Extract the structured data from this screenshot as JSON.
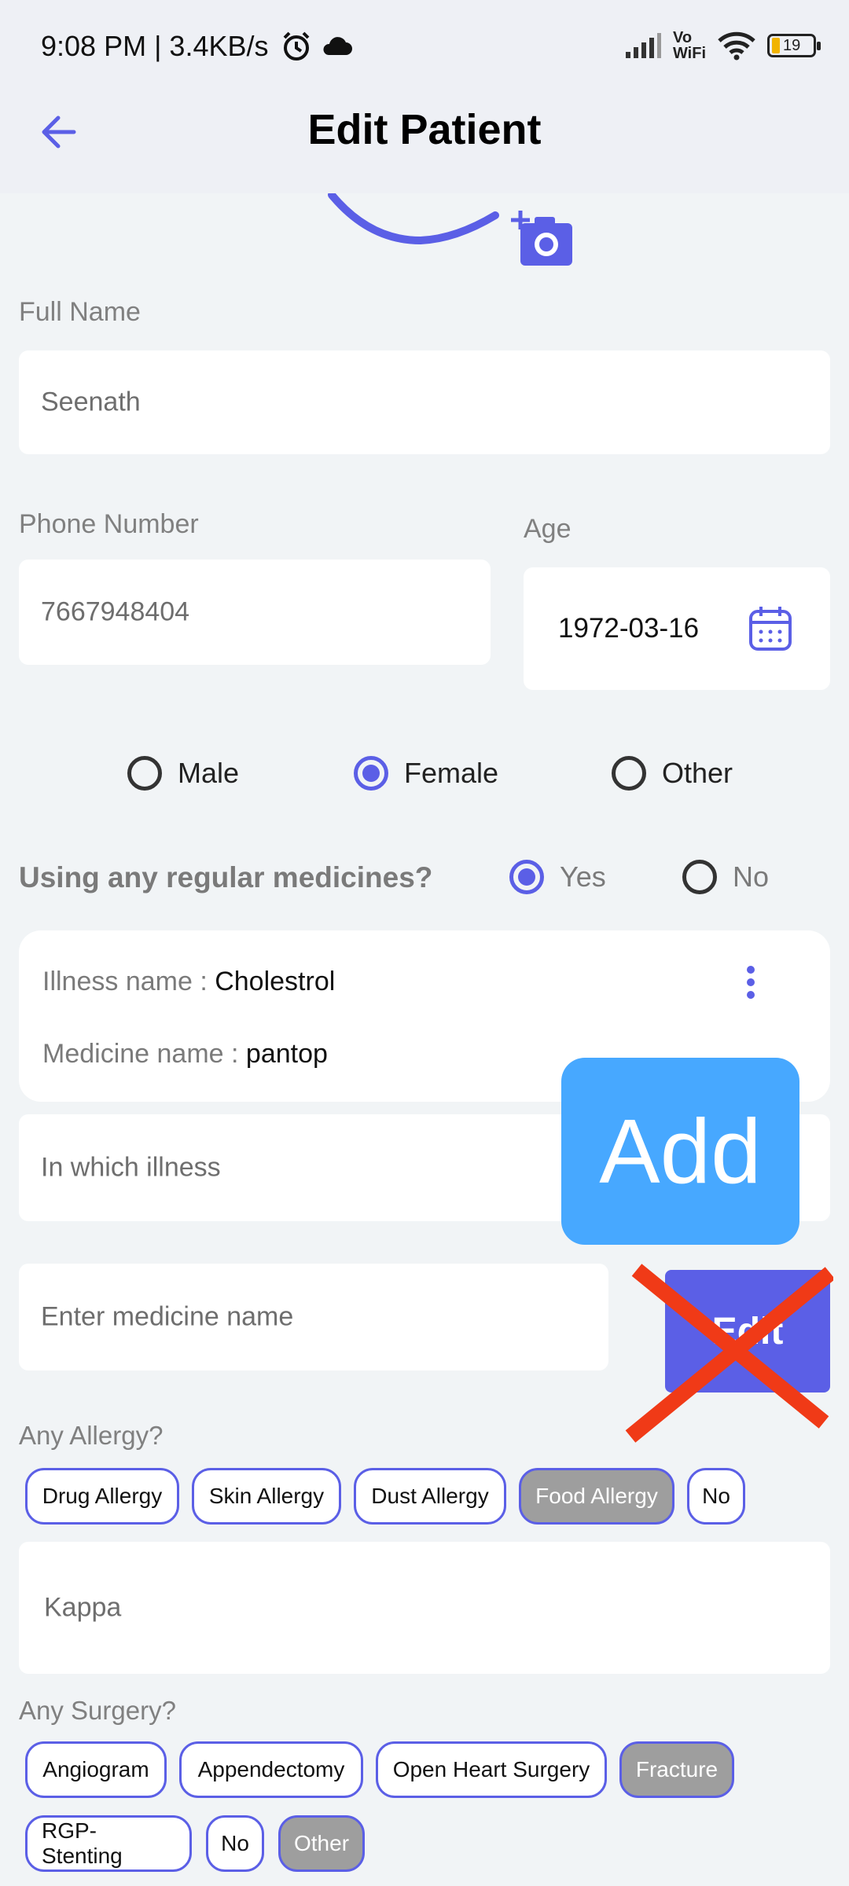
{
  "status_bar": {
    "time_speed": "9:08 PM | 3.4KB/s",
    "vowifi": "Vo\nWiFi",
    "battery": "19"
  },
  "header": {
    "title": "Edit Patient"
  },
  "full_name": {
    "label": "Full Name",
    "value": "Seenath"
  },
  "phone": {
    "label": "Phone Number",
    "value": "7667948404"
  },
  "age": {
    "label": "Age",
    "value": "1972-03-16"
  },
  "gender": {
    "options": [
      "Male",
      "Female",
      "Other"
    ],
    "selected": "Female"
  },
  "medicines": {
    "question": "Using any regular medicines?",
    "yes": "Yes",
    "no": "No",
    "selected": "Yes",
    "entry": {
      "illness_label": "Illness name : ",
      "illness_value": "Cholestrol",
      "medicine_label": "Medicine name : ",
      "medicine_value": "pantop"
    },
    "illness_placeholder": "In which illness",
    "medicine_placeholder": "Enter medicine name",
    "add_label": "Add",
    "edit_label": "Edit"
  },
  "allergy": {
    "question": "Any Allergy?",
    "chips": [
      "Drug Allergy",
      "Skin Allergy",
      "Dust Allergy",
      "Food Allergy",
      "No"
    ],
    "selected": [
      "Food Allergy"
    ],
    "note": "Kappa"
  },
  "surgery": {
    "question": "Any Surgery?",
    "chips": [
      "Angiogram",
      "Appendectomy",
      "Open Heart Surgery",
      "Fracture",
      "RGP-Stenting",
      "No",
      "Other"
    ],
    "selected": [
      "Fracture",
      "Other"
    ]
  },
  "colors": {
    "accent": "#5b5fe6",
    "add_button": "#47a8ff",
    "cross": "#f03a17",
    "chip_selected": "#9e9e9e"
  }
}
